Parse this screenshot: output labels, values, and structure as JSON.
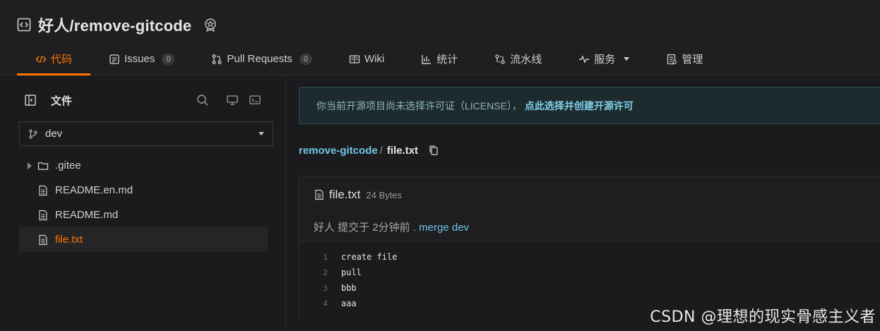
{
  "repo": {
    "title": "好人/remove-gitcode"
  },
  "tabs": [
    {
      "label": "代码",
      "icon": "code-icon",
      "active": true
    },
    {
      "label": "Issues",
      "icon": "issues-icon",
      "count": "0"
    },
    {
      "label": "Pull Requests",
      "icon": "pull-request-icon",
      "count": "0"
    },
    {
      "label": "Wiki",
      "icon": "wiki-icon"
    },
    {
      "label": "统计",
      "icon": "chart-icon"
    },
    {
      "label": "流水线",
      "icon": "pipeline-icon"
    },
    {
      "label": "服务",
      "icon": "pulse-icon"
    },
    {
      "label": "管理",
      "icon": "manage-icon"
    }
  ],
  "sidebar": {
    "label": "文件",
    "branch": "dev",
    "tree": [
      {
        "name": ".gitee",
        "type": "folder"
      },
      {
        "name": "README.en.md",
        "type": "file"
      },
      {
        "name": "README.md",
        "type": "file"
      },
      {
        "name": "file.txt",
        "type": "file",
        "selected": true
      }
    ]
  },
  "notice": {
    "text": "你当前开源项目尚未选择许可证（LICENSE），",
    "link": "点此选择并创建开源许可"
  },
  "breadcrumb": {
    "repo": "remove-gitcode",
    "sep": "/",
    "file": "file.txt"
  },
  "file": {
    "name": "file.txt",
    "size": "24 Bytes",
    "commit_prefix": "好人 提交于 2分钟前 .",
    "commit_msg": " merge dev",
    "lines": [
      {
        "no": "1",
        "text": "create file"
      },
      {
        "no": "2",
        "text": "pull"
      },
      {
        "no": "3",
        "text": "bbb"
      },
      {
        "no": "4",
        "text": "aaa"
      }
    ]
  },
  "watermark": "CSDN @理想的现实骨感主义者",
  "colors": {
    "accent": "#fe7300",
    "link": "#6fc6e4"
  }
}
